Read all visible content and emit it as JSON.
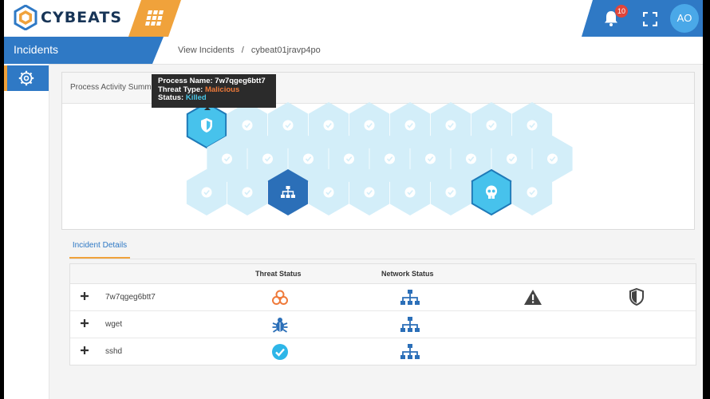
{
  "header": {
    "logo_text": "CYBEATS",
    "notifications_count": "10",
    "avatar_initials": "AO"
  },
  "section_title": "Incidents",
  "breadcrumb": {
    "parent": "View Incidents",
    "separator": "/",
    "current": "cybeat01jravp4po"
  },
  "panel": {
    "title": "Process Activity Summary"
  },
  "tooltip": {
    "name_label": "Process Name:",
    "name_value": "7w7qgeg6btt7",
    "type_label": "Threat Type:",
    "type_value": "Malicious",
    "status_label": "Status:",
    "status_value": "Killed"
  },
  "hex_grid": {
    "rows": [
      [
        "shield",
        "check",
        "check",
        "check",
        "check",
        "check",
        "check",
        "check",
        "check"
      ],
      [
        "check",
        "check",
        "check",
        "check",
        "check",
        "check",
        "check",
        "check",
        "check"
      ],
      [
        "check",
        "check",
        "network",
        "check",
        "check",
        "check",
        "check",
        "skull",
        "check"
      ]
    ],
    "colors": {
      "light": "#d3eef9",
      "check": "#ffffff",
      "selected": "#47c2ec",
      "network": "#2b6fb8",
      "outline": "#1f7ab8"
    }
  },
  "details": {
    "tab_label": "Incident Details",
    "columns": {
      "threat": "Threat Status",
      "network": "Network Status"
    },
    "rows": [
      {
        "name": "7w7qgeg6btt7",
        "threat_icon": "biohazard-icon",
        "network_icon": "network-icon",
        "extra": [
          "warning-icon",
          "shield-icon"
        ]
      },
      {
        "name": "wget",
        "threat_icon": "bug-icon",
        "network_icon": "network-icon",
        "extra": []
      },
      {
        "name": "sshd",
        "threat_icon": "check-circle-icon",
        "network_icon": "network-icon",
        "extra": []
      }
    ]
  },
  "colors": {
    "accent": "#2f79c5",
    "orange": "#f0a23b",
    "danger": "#ef7a3a",
    "cyan": "#2eb6e8"
  }
}
